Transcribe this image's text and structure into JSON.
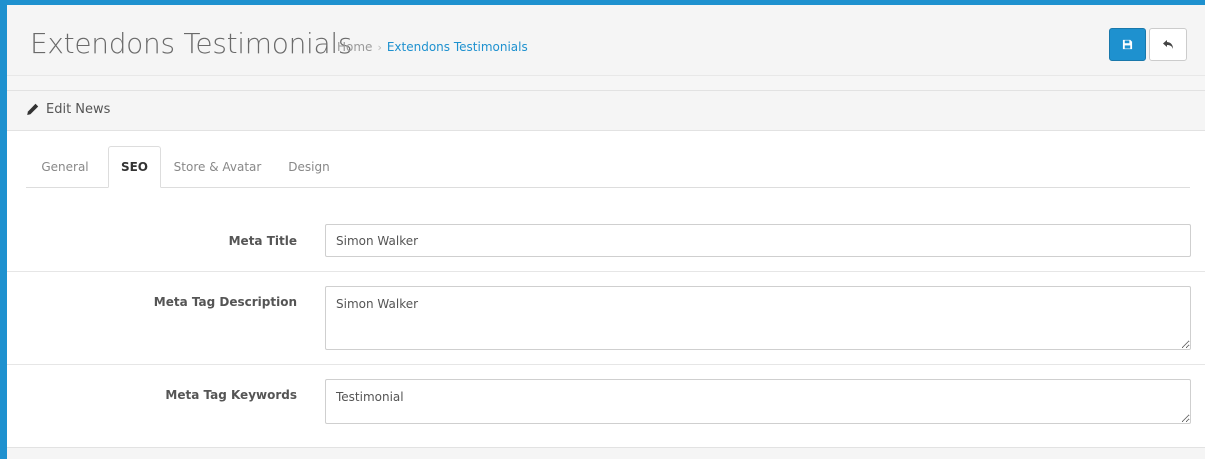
{
  "header": {
    "title": "Extendons Testimonials",
    "breadcrumb": {
      "home": "Home",
      "separator": "›",
      "current": "Extendons Testimonials"
    },
    "buttons": {
      "save_icon": "save-icon",
      "back_icon": "reply-icon"
    }
  },
  "panel": {
    "heading_icon": "pencil-icon",
    "heading": "Edit News",
    "tabs": [
      {
        "label": "General",
        "active": false
      },
      {
        "label": "SEO",
        "active": true
      },
      {
        "label": "Store & Avatar",
        "active": false
      },
      {
        "label": "Design",
        "active": false
      }
    ],
    "fields": {
      "meta_title": {
        "label": "Meta Title",
        "value": "Simon Walker"
      },
      "meta_description": {
        "label": "Meta Tag Description",
        "value": "Simon Walker"
      },
      "meta_keywords": {
        "label": "Meta Tag Keywords",
        "value": "Testimonial"
      }
    }
  },
  "colors": {
    "accent": "#1e91cf",
    "frame_border": "#1e91cf",
    "header_bg": "#f5f5f5"
  }
}
